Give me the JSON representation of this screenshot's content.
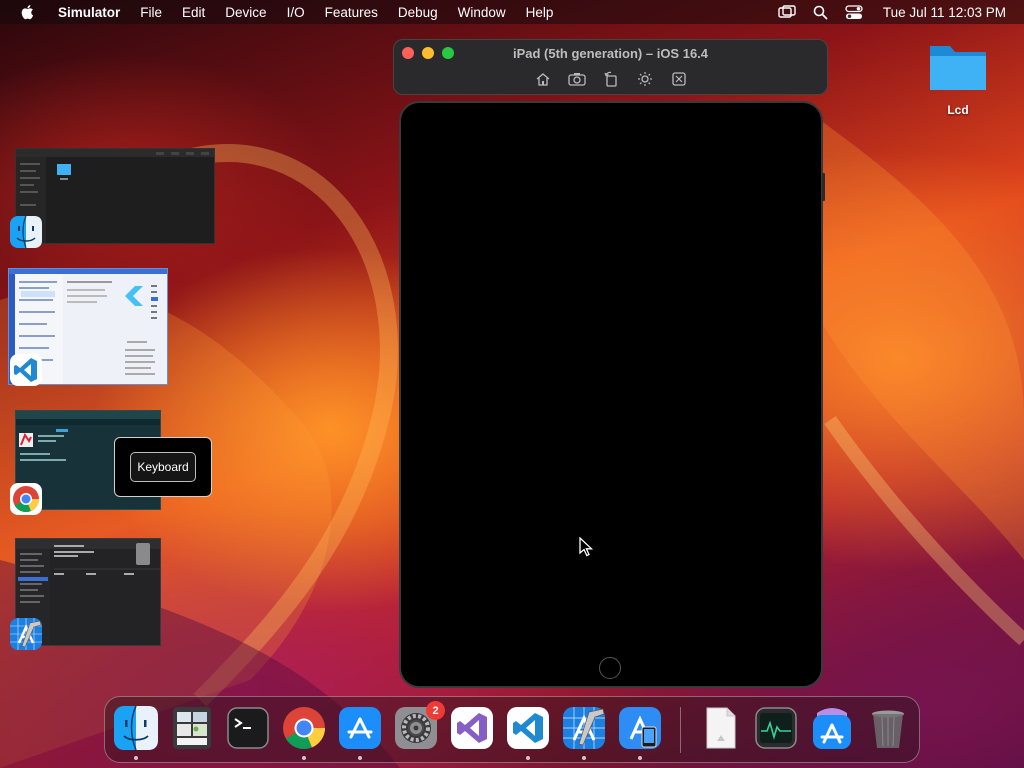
{
  "menubar": {
    "apple_icon": "apple-icon",
    "app_name": "Simulator",
    "items": [
      "File",
      "Edit",
      "Device",
      "I/O",
      "Features",
      "Debug",
      "Window",
      "Help"
    ],
    "status_icons": [
      "screen-mirroring-icon",
      "spotlight-search-icon",
      "control-center-icon"
    ],
    "clock": "Tue Jul 11  12:03 PM"
  },
  "simulator_window": {
    "title": "iPad (5th generation) – iOS 16.4",
    "toolbar": [
      "home-icon",
      "screenshot-icon",
      "rotate-icon",
      "appearance-icon",
      "shake-icon"
    ]
  },
  "desktop": {
    "folder_label": "Lcd"
  },
  "app_switcher": {
    "windows": [
      {
        "app": "Finder",
        "icon": "finder-icon"
      },
      {
        "app": "Visual Studio Code",
        "icon": "vscode-icon"
      },
      {
        "app": "Google Chrome",
        "icon": "chrome-icon"
      },
      {
        "app": "Xcode",
        "icon": "xcode-icon"
      }
    ],
    "popup_label": "Keyboard"
  },
  "dock": {
    "items": [
      {
        "name": "Finder",
        "icon": "finder-icon",
        "running": true
      },
      {
        "name": "Gallery",
        "icon": "gallery-icon",
        "running": false
      },
      {
        "name": "Terminal",
        "icon": "terminal-icon",
        "running": false
      },
      {
        "name": "Google Chrome",
        "icon": "chrome-icon",
        "running": true
      },
      {
        "name": "App Store",
        "icon": "app-store-icon",
        "running": true
      },
      {
        "name": "System Settings",
        "icon": "system-settings-icon",
        "running": false,
        "badge": "2"
      },
      {
        "name": "Visual Studio",
        "icon": "visual-studio-icon",
        "running": false
      },
      {
        "name": "Visual Studio Code",
        "icon": "vscode-icon",
        "running": true
      },
      {
        "name": "Xcode",
        "icon": "xcode-icon",
        "running": true
      },
      {
        "name": "Simulator",
        "icon": "simulator-icon",
        "running": true
      },
      {
        "name": "Document",
        "icon": "document-icon",
        "running": false
      },
      {
        "name": "Activity Monitor",
        "icon": "activity-monitor-icon",
        "running": false
      },
      {
        "name": "App Store Downloads",
        "icon": "app-store-downloads-icon",
        "running": false
      },
      {
        "name": "Trash",
        "icon": "trash-icon",
        "running": false
      }
    ]
  }
}
